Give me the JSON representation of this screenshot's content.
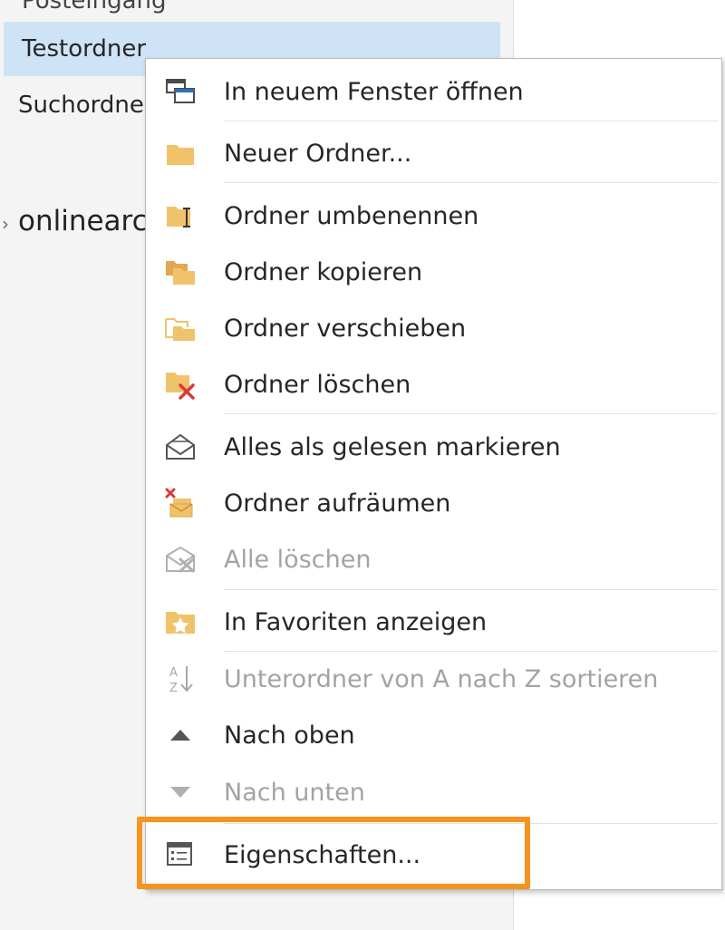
{
  "folder_pane": {
    "top_partial": "Posteingang",
    "folders": [
      {
        "label": "Testordner",
        "selected": true
      },
      {
        "label": "Suchordner",
        "selected": false
      }
    ],
    "account": "onlinearchiv"
  },
  "context_menu": {
    "items": [
      {
        "label": "In neuem Fenster öffnen",
        "icon": "open-new-window-icon",
        "enabled": true
      },
      {
        "label": "Neuer Ordner...",
        "icon": "new-folder-icon",
        "enabled": true
      },
      {
        "label": "Ordner umbenennen",
        "icon": "rename-folder-icon",
        "enabled": true
      },
      {
        "label": "Ordner kopieren",
        "icon": "copy-folder-icon",
        "enabled": true
      },
      {
        "label": "Ordner verschieben",
        "icon": "move-folder-icon",
        "enabled": true
      },
      {
        "label": "Ordner löschen",
        "icon": "delete-folder-icon",
        "enabled": true
      },
      {
        "label": "Alles als gelesen markieren",
        "icon": "mark-all-read-icon",
        "enabled": true
      },
      {
        "label": "Ordner aufräumen",
        "icon": "clean-up-folder-icon",
        "enabled": true
      },
      {
        "label": "Alle löschen",
        "icon": "delete-all-icon",
        "enabled": false
      },
      {
        "label": "In Favoriten anzeigen",
        "icon": "favorites-icon",
        "enabled": true
      },
      {
        "label": "Unterordner von A nach Z sortieren",
        "icon": "sort-a-z-icon",
        "enabled": false
      },
      {
        "label": "Nach oben",
        "icon": "move-up-icon",
        "enabled": true
      },
      {
        "label": "Nach unten",
        "icon": "move-down-icon",
        "enabled": false
      },
      {
        "label": "Eigenschaften...",
        "icon": "properties-icon",
        "enabled": true
      }
    ]
  },
  "colors": {
    "folder_yellow": "#f0c36b",
    "selection_blue": "#cfe3f7",
    "highlight_orange": "#f7941d",
    "delete_red": "#d83b3b"
  }
}
